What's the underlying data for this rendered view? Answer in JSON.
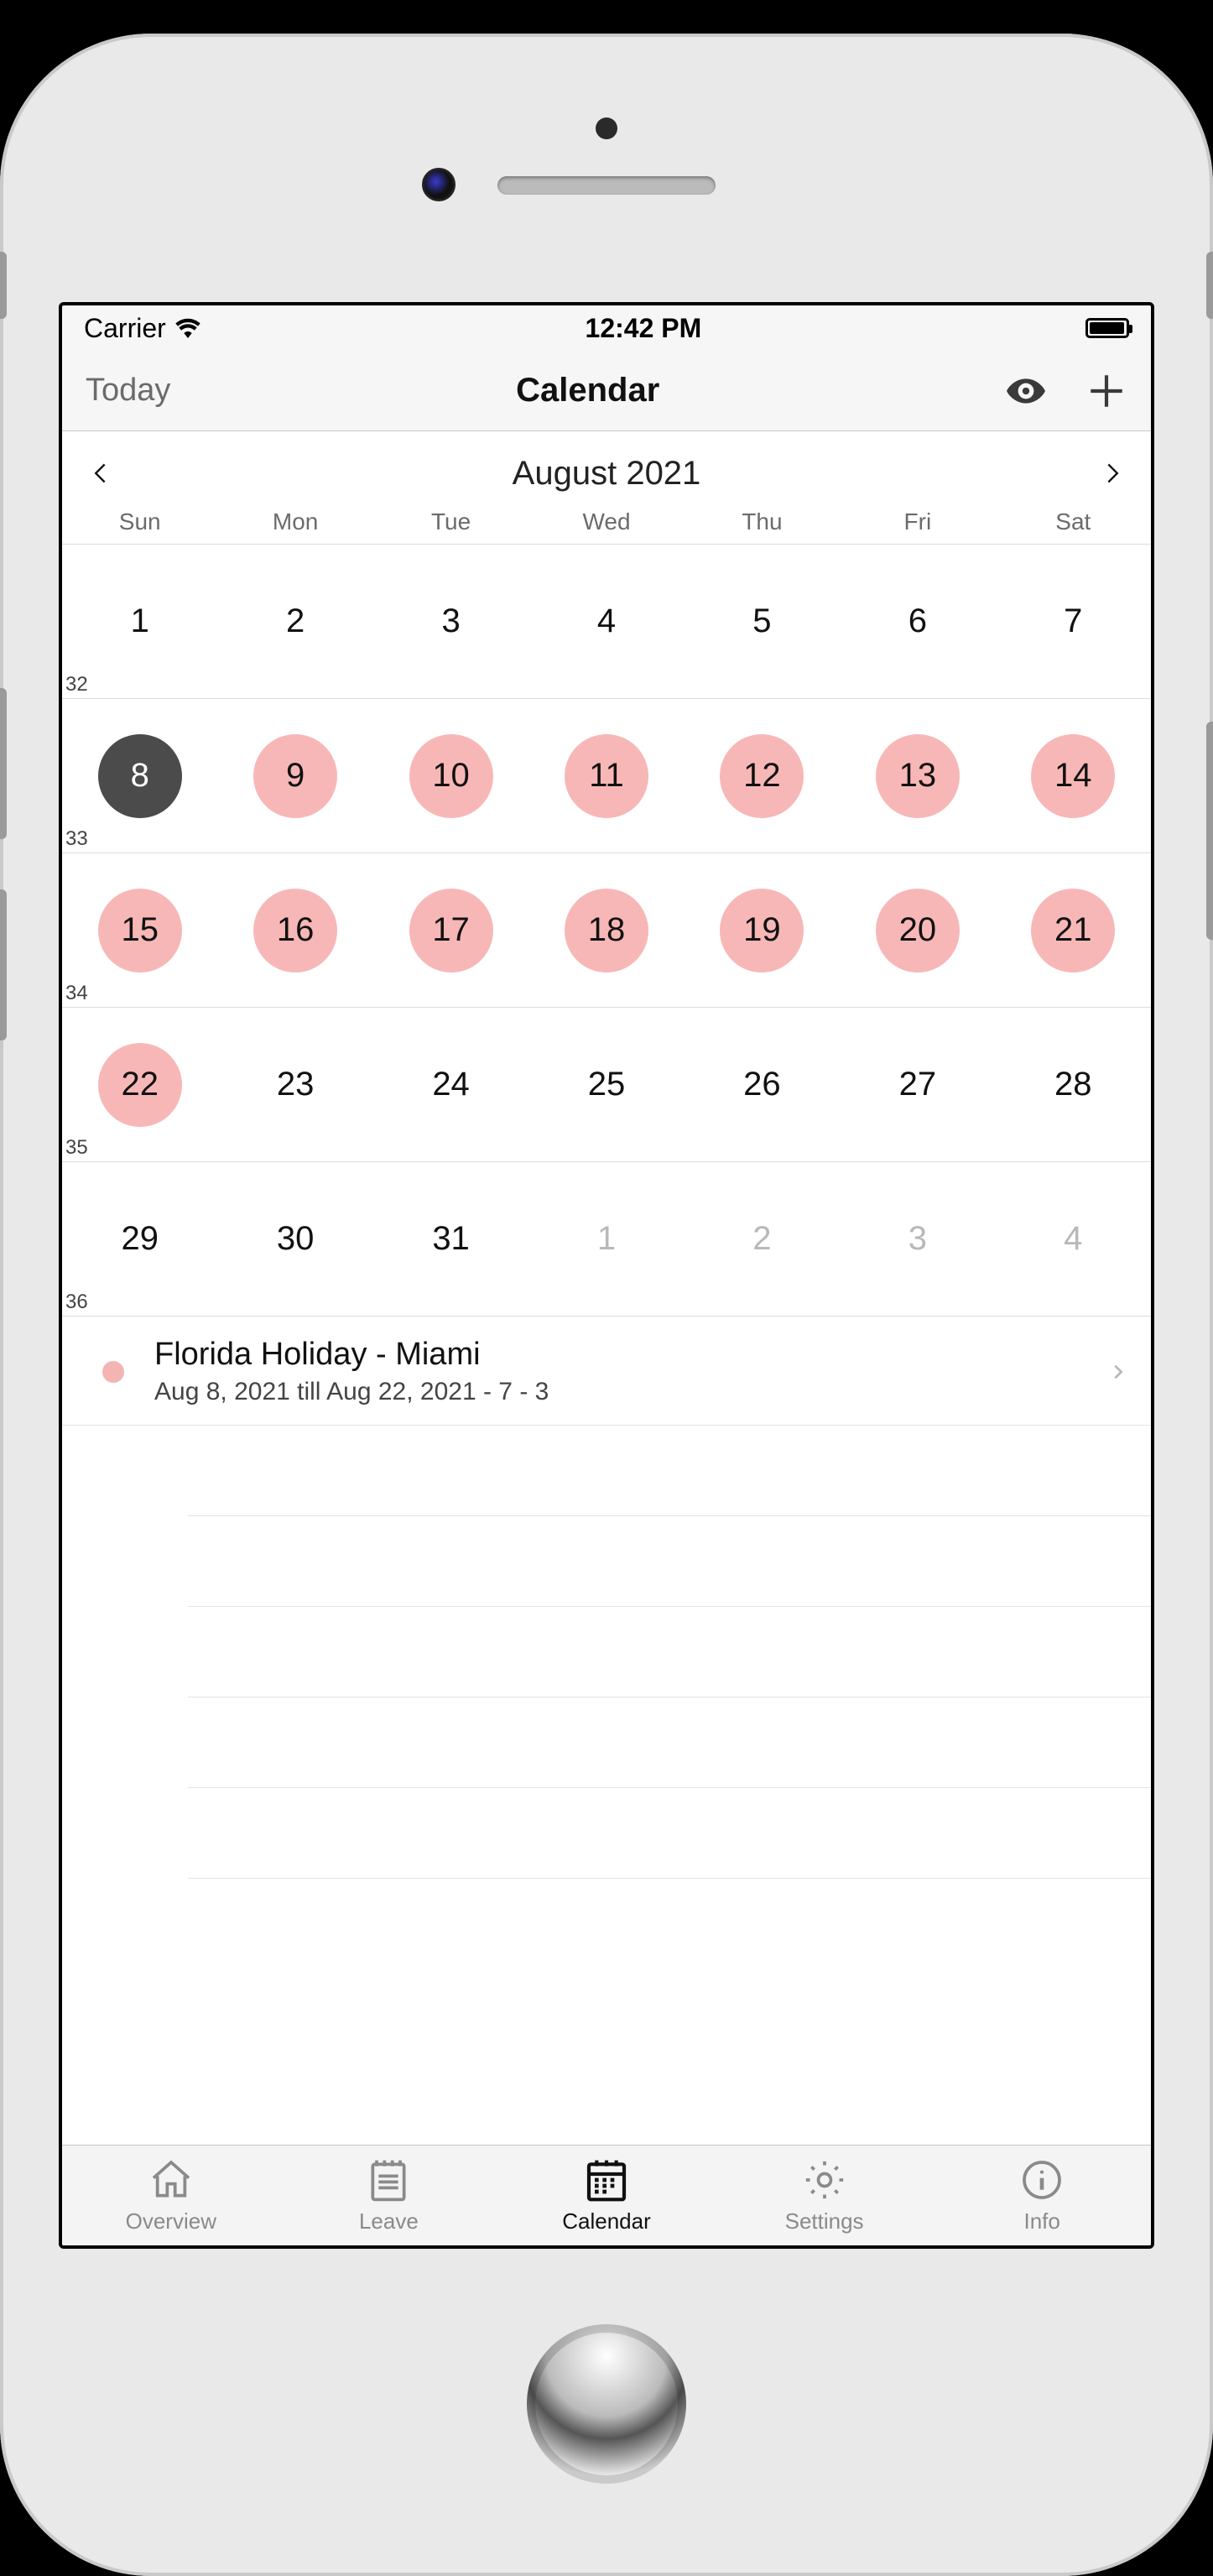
{
  "status": {
    "carrier": "Carrier",
    "time": "12:42 PM"
  },
  "nav": {
    "today": "Today",
    "title": "Calendar"
  },
  "month": {
    "title": "August 2021",
    "weekdays": [
      "Sun",
      "Mon",
      "Tue",
      "Wed",
      "Thu",
      "Fri",
      "Sat"
    ]
  },
  "weeks": [
    {
      "num": "32",
      "days": [
        {
          "n": "1"
        },
        {
          "n": "2"
        },
        {
          "n": "3"
        },
        {
          "n": "4"
        },
        {
          "n": "5"
        },
        {
          "n": "6"
        },
        {
          "n": "7"
        }
      ]
    },
    {
      "num": "33",
      "days": [
        {
          "n": "8",
          "today": true
        },
        {
          "n": "9",
          "marked": true
        },
        {
          "n": "10",
          "marked": true
        },
        {
          "n": "11",
          "marked": true
        },
        {
          "n": "12",
          "marked": true
        },
        {
          "n": "13",
          "marked": true
        },
        {
          "n": "14",
          "marked": true
        }
      ]
    },
    {
      "num": "34",
      "days": [
        {
          "n": "15",
          "marked": true
        },
        {
          "n": "16",
          "marked": true
        },
        {
          "n": "17",
          "marked": true
        },
        {
          "n": "18",
          "marked": true
        },
        {
          "n": "19",
          "marked": true
        },
        {
          "n": "20",
          "marked": true
        },
        {
          "n": "21",
          "marked": true
        }
      ]
    },
    {
      "num": "35",
      "days": [
        {
          "n": "22",
          "marked": true
        },
        {
          "n": "23"
        },
        {
          "n": "24"
        },
        {
          "n": "25"
        },
        {
          "n": "26"
        },
        {
          "n": "27"
        },
        {
          "n": "28"
        }
      ]
    },
    {
      "num": "36",
      "days": [
        {
          "n": "29"
        },
        {
          "n": "30"
        },
        {
          "n": "31"
        },
        {
          "n": "1",
          "other": true
        },
        {
          "n": "2",
          "other": true
        },
        {
          "n": "3",
          "other": true
        },
        {
          "n": "4",
          "other": true
        }
      ]
    }
  ],
  "events": [
    {
      "title": "Florida Holiday - Miami",
      "subtitle": "Aug 8, 2021 till Aug 22, 2021 - 7 - 3"
    }
  ],
  "tabs": [
    {
      "label": "Overview"
    },
    {
      "label": "Leave"
    },
    {
      "label": "Calendar",
      "active": true
    },
    {
      "label": "Settings"
    },
    {
      "label": "Info"
    }
  ]
}
